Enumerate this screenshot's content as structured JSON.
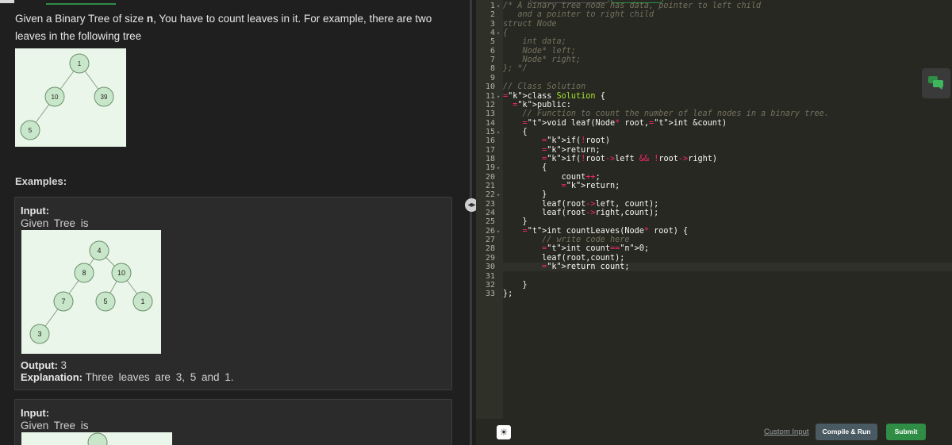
{
  "problem": {
    "desc_pre": "Given a Binary Tree of size ",
    "desc_n": "n",
    "desc_post": ", You have to count leaves in it. For example, there are two leaves in the following tree",
    "tree1_nodes": [
      "1",
      "10",
      "39",
      "5"
    ],
    "examples_heading": "Examples:",
    "example1": {
      "input_label": "Input:",
      "input_value": "Given Tree is",
      "tree_nodes": [
        "4",
        "8",
        "10",
        "7",
        "5",
        "1",
        "3"
      ],
      "output_label": "Output:",
      "output_value": "3",
      "explanation_label": "Explanation:",
      "explanation_value": "Three leaves are 3, 5 and 1."
    },
    "example2": {
      "input_label": "Input:",
      "input_value": "Given Tree is"
    }
  },
  "editor": {
    "line_numbers": [
      "1",
      "2",
      "3",
      "4",
      "5",
      "6",
      "7",
      "8",
      "9",
      "10",
      "11",
      "12",
      "13",
      "14",
      "15",
      "16",
      "17",
      "18",
      "19",
      "20",
      "21",
      "22",
      "23",
      "24",
      "25",
      "26",
      "27",
      "28",
      "29",
      "30",
      "31",
      "32",
      "33"
    ],
    "lines": [
      "/* A binary tree node has data, pointer to left child",
      "   and a pointer to right child",
      "struct Node",
      "{",
      "    int data;",
      "    Node* left;",
      "    Node* right;",
      "}; */",
      "",
      "// Class Solution",
      "class Solution {",
      "  public:",
      "    // Function to count the number of leaf nodes in a binary tree.",
      "    void leaf(Node* root,int &count)",
      "    {",
      "        if(!root)",
      "        return;",
      "        if(!root->left && !root->right)",
      "        {",
      "            count++;",
      "            return;",
      "        }",
      "        leaf(root->left, count);",
      "        leaf(root->right,count);",
      "    }",
      "    int countLeaves(Node* root) {",
      "        // write code here",
      "        int count=0;",
      "        leaf(root,count);",
      "        return count;",
      "",
      "    }",
      "};"
    ]
  },
  "actions": {
    "custom_input": "Custom Input",
    "compile_run": "Compile & Run",
    "submit": "Submit"
  },
  "icons": {
    "splitter": "resize-handle-icon",
    "bulb": "lightbulb-icon",
    "chat": "chat-icon"
  },
  "colors": {
    "accent": "#2f8d46",
    "node_fill": "#c8e6c9",
    "node_stroke": "#6b8e6b",
    "tree_bg": "#eaf6ea"
  }
}
